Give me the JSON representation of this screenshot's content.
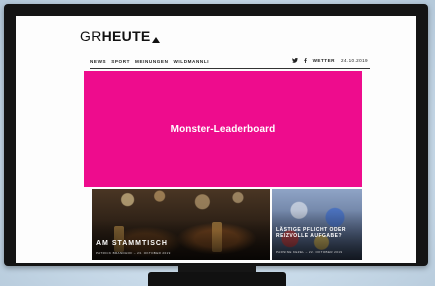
{
  "site": {
    "logo_light": "GR",
    "logo_bold": "HEUTE"
  },
  "nav": {
    "items": [
      "NEWS",
      "SPORT",
      "MEINUNGEN",
      "WILDMANNLI"
    ],
    "weather_label": "WETTER",
    "date": "24.10.2019",
    "icons": [
      "twitter-icon",
      "facebook-icon"
    ]
  },
  "leaderboard": {
    "label": "Monster-Leaderboard",
    "color": "#ee0c8d"
  },
  "articles": [
    {
      "title": "AM STAMMTISCH",
      "meta": "PATRICK BRANDHOF – 23. OKTOBER 2019"
    },
    {
      "title": "LÄSTIGE PFLICHT ODER REIZVOLLE AUFGABE?",
      "meta": "PARSINE KEZEL – 22. OKTOBER 2019"
    }
  ]
}
